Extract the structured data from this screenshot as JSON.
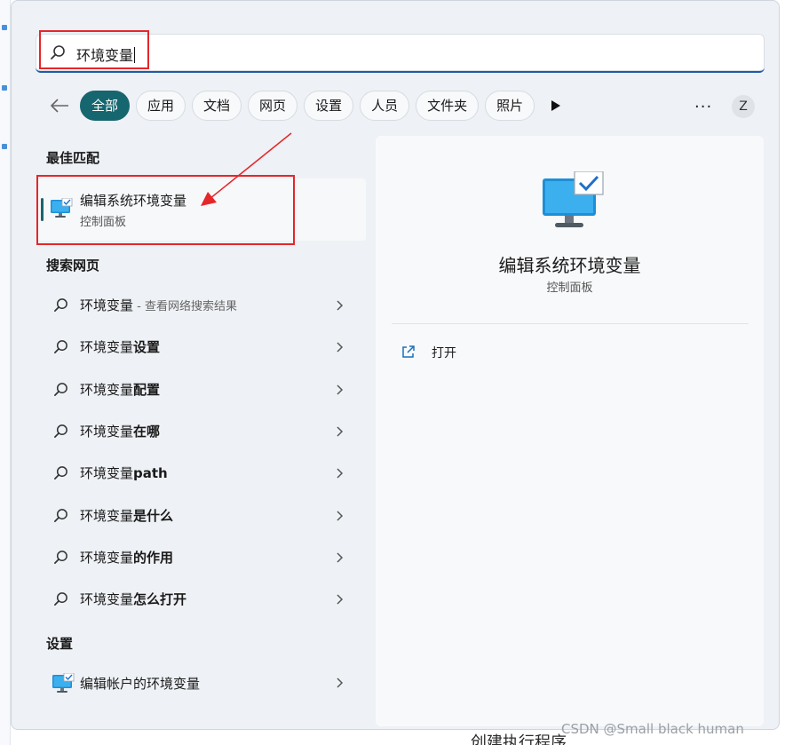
{
  "search": {
    "query": "环境变量"
  },
  "filters": {
    "chips": [
      "全部",
      "应用",
      "文档",
      "网页",
      "设置",
      "人员",
      "文件夹",
      "照片"
    ],
    "active_index": 0,
    "more_label": "···",
    "avatar_letter": "Z"
  },
  "best_match": {
    "section_title": "最佳匹配",
    "title": "编辑系统环境变量",
    "subtitle": "控制面板"
  },
  "web": {
    "section_title": "搜索网页",
    "items": [
      {
        "prefix": "环境变量",
        "bold": "",
        "suffix": " - 查看网络搜索结果"
      },
      {
        "prefix": "环境变量",
        "bold": "设置",
        "suffix": ""
      },
      {
        "prefix": "环境变量",
        "bold": "配置",
        "suffix": ""
      },
      {
        "prefix": "环境变量",
        "bold": "在哪",
        "suffix": ""
      },
      {
        "prefix": "环境变量",
        "bold": "path",
        "suffix": ""
      },
      {
        "prefix": "环境变量",
        "bold": "是什么",
        "suffix": ""
      },
      {
        "prefix": "环境变量",
        "bold": "的作用",
        "suffix": ""
      },
      {
        "prefix": "环境变量",
        "bold": "怎么打开",
        "suffix": ""
      }
    ]
  },
  "settings": {
    "section_title": "设置",
    "item_label": "编辑帐户的环境变量"
  },
  "detail": {
    "title": "编辑系统环境变量",
    "subtitle": "控制面板",
    "open_label": "打开"
  },
  "background": {
    "bottom_text": "创建执行程序",
    "watermark": "CSDN @Small black human"
  },
  "colors": {
    "accent": "#16666f",
    "highlight_red": "#e5262b",
    "search_underline": "#1c5ca8"
  }
}
